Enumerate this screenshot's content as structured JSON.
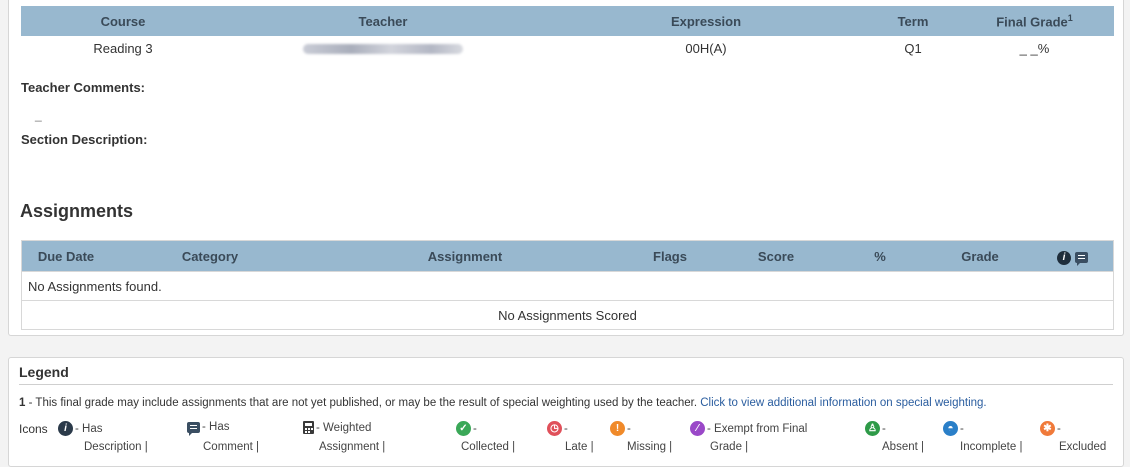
{
  "course_table": {
    "headers": {
      "course": "Course",
      "teacher": "Teacher",
      "expression": "Expression",
      "term": "Term",
      "final_grade": "Final Grade",
      "final_grade_sup": "1"
    },
    "row": {
      "course": "Reading 3",
      "expression": "00H(A)",
      "term": "Q1",
      "final_grade": "_ _%"
    }
  },
  "teacher_comments_label": "Teacher Comments:",
  "teacher_comments_value": "_",
  "section_description_label": "Section Description:",
  "assignments": {
    "heading": "Assignments",
    "headers": {
      "due_date": "Due Date",
      "category": "Category",
      "assignment": "Assignment",
      "flags": "Flags",
      "score": "Score",
      "percent": "%",
      "grade": "Grade"
    },
    "no_found": "No Assignments found.",
    "no_scored": "No Assignments Scored"
  },
  "legend": {
    "title": "Legend",
    "note_number": "1",
    "note_text": " - This final grade may include assignments that are not yet published, or may be the result of special weighting used by the teacher. ",
    "note_link": "Click to view additional information on special weighting.",
    "icons_label": "Icons",
    "items": [
      {
        "icon": "info-icon",
        "color": "#2b3a4a",
        "top": "- Has",
        "bottom": "Description  |"
      },
      {
        "icon": "comment-icon",
        "color": "#3a4e62",
        "top": "- Has",
        "bottom": "Comment  |"
      },
      {
        "icon": "calculator-icon",
        "color": "#3a3a3a",
        "top": "- Weighted",
        "bottom": "Assignment  |"
      },
      {
        "icon": "check-icon",
        "color": "#3aa858",
        "top": "-",
        "bottom": "Collected  |"
      },
      {
        "icon": "clock-icon",
        "color": "#e0505a",
        "top": "-",
        "bottom": "Late  |"
      },
      {
        "icon": "exclamation-icon",
        "color": "#f08a2a",
        "top": "-",
        "bottom": "Missing  |"
      },
      {
        "icon": "slash-icon",
        "color": "#9a48c8",
        "top": "- Exempt from Final",
        "bottom": "Grade  |"
      },
      {
        "icon": "absent-icon",
        "color": "#2e9a48",
        "top": "-",
        "bottom": "Absent  |"
      },
      {
        "icon": "incomplete-icon",
        "color": "#2a7fc8",
        "top": "-",
        "bottom": "Incomplete  |"
      },
      {
        "icon": "excluded-icon",
        "color": "#f07a3a",
        "top": "-",
        "bottom": "Excluded"
      }
    ]
  }
}
